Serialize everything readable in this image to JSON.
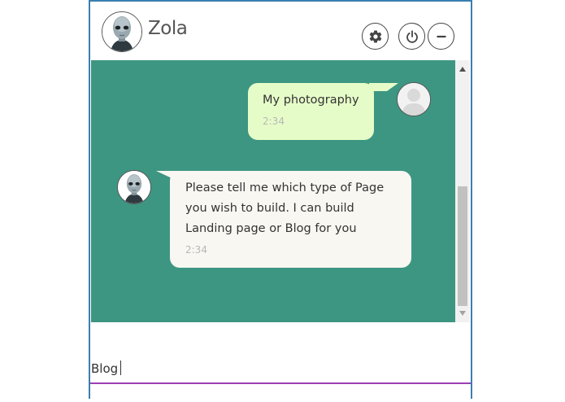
{
  "header": {
    "bot_name": "Zola",
    "buttons": [
      {
        "icon": "gear-icon"
      },
      {
        "icon": "power-icon"
      },
      {
        "icon": "minimize-icon"
      }
    ]
  },
  "messages": [
    {
      "sender": "user",
      "text": "My photography",
      "time": "2:34",
      "bubble_color": "#e6fcc8"
    },
    {
      "sender": "bot",
      "lines": [
        "Please tell me which type of Page",
        "you wish to build. I can build",
        "Landing page or Blog for you"
      ],
      "time": "2:34",
      "bubble_color": "#f8f7f2"
    }
  ],
  "input": {
    "value": "Blog",
    "accent_color": "#9b3fb5"
  },
  "colors": {
    "chat_background": "#3d9682",
    "window_border": "#3a7fb0"
  }
}
